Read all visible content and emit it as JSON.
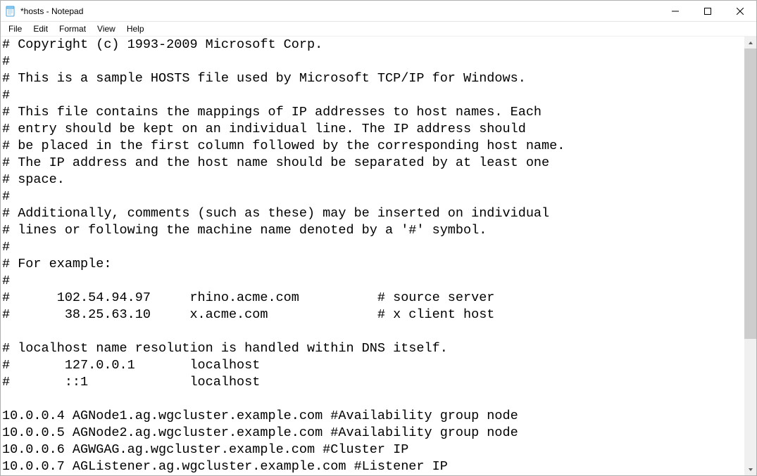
{
  "window": {
    "title": "*hosts - Notepad"
  },
  "menu": {
    "file": "File",
    "edit": "Edit",
    "format": "Format",
    "view": "View",
    "help": "Help"
  },
  "content": "# Copyright (c) 1993-2009 Microsoft Corp.\n#\n# This is a sample HOSTS file used by Microsoft TCP/IP for Windows.\n#\n# This file contains the mappings of IP addresses to host names. Each\n# entry should be kept on an individual line. The IP address should\n# be placed in the first column followed by the corresponding host name.\n# The IP address and the host name should be separated by at least one\n# space.\n#\n# Additionally, comments (such as these) may be inserted on individual\n# lines or following the machine name denoted by a '#' symbol.\n#\n# For example:\n#\n#      102.54.94.97     rhino.acme.com          # source server\n#       38.25.63.10     x.acme.com              # x client host\n\n# localhost name resolution is handled within DNS itself.\n#       127.0.0.1       localhost\n#       ::1             localhost\n\n10.0.0.4 AGNode1.ag.wgcluster.example.com #Availability group node\n10.0.0.5 AGNode2.ag.wgcluster.example.com #Availability group node\n10.0.0.6 AGWGAG.ag.wgcluster.example.com #Cluster IP\n10.0.0.7 AGListener.ag.wgcluster.example.com #Listener IP"
}
